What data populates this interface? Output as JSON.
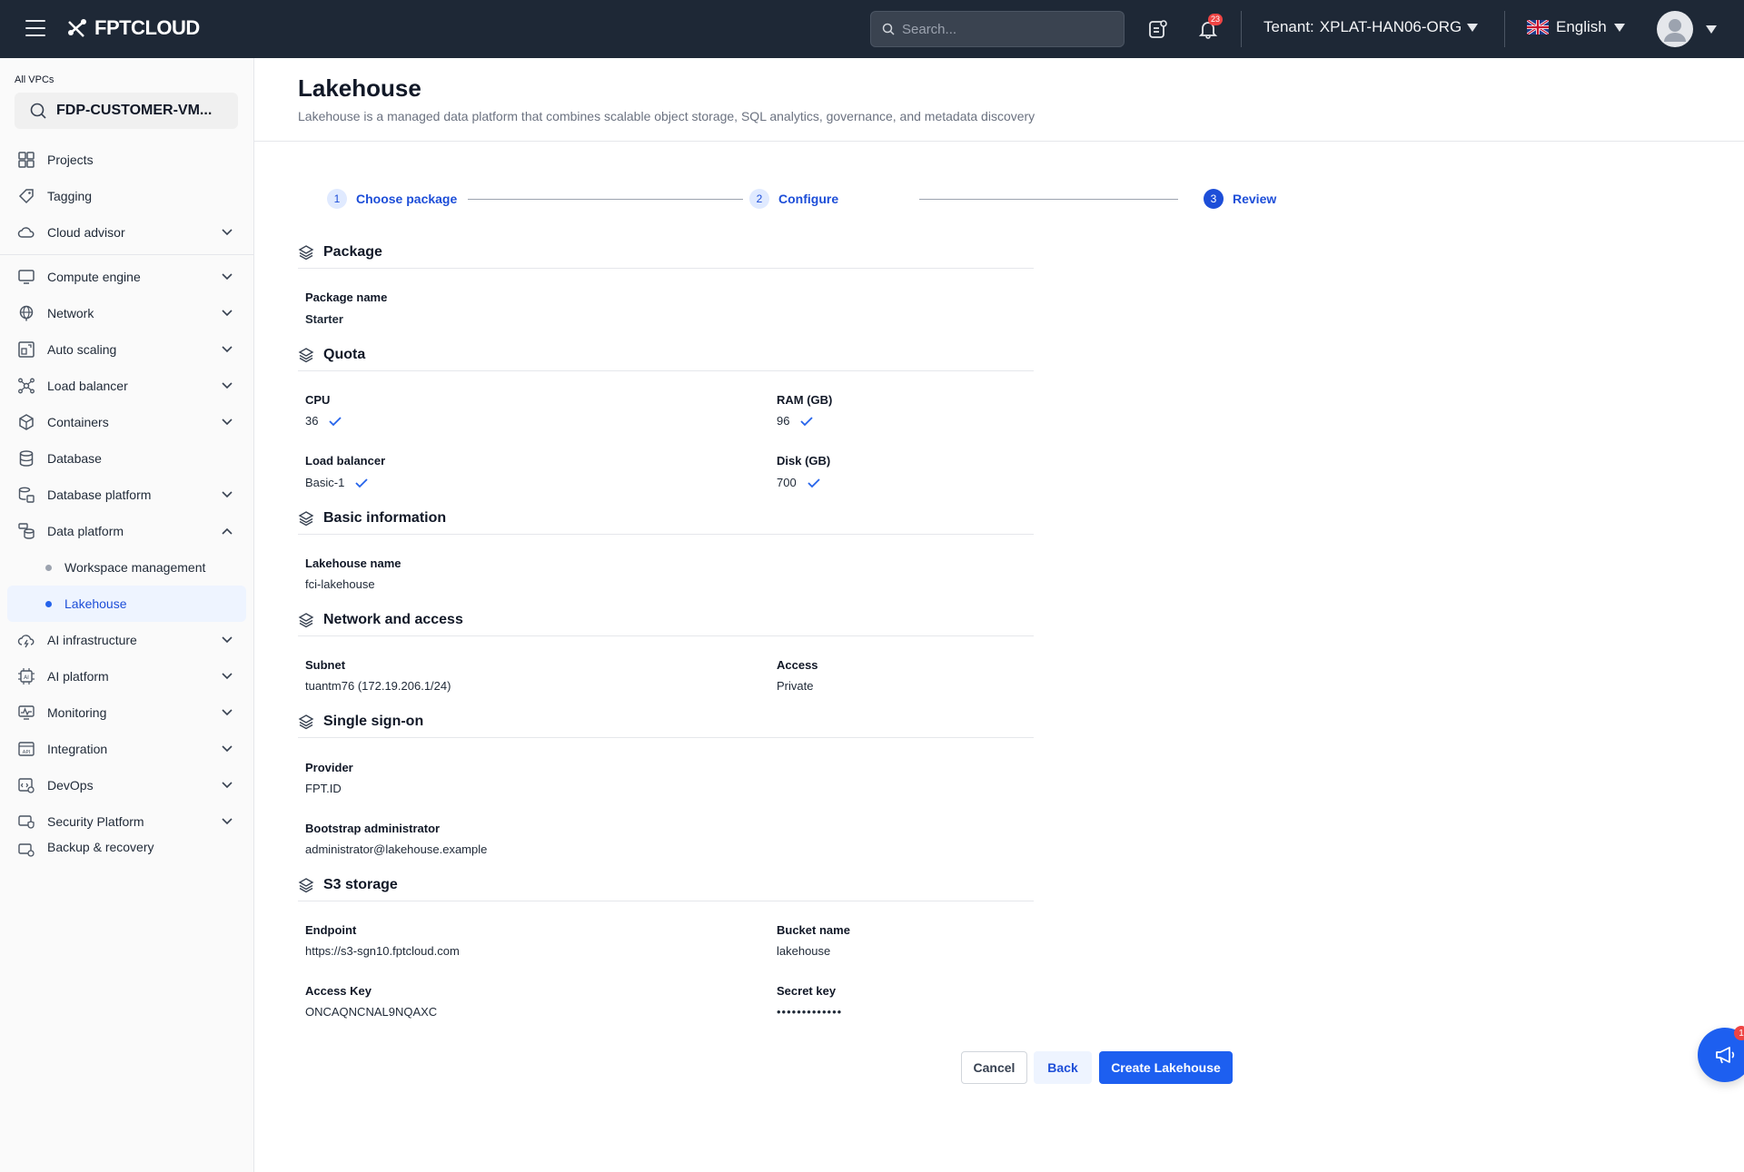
{
  "topbar": {
    "logo_text": "FPTCLOUD",
    "search_placeholder": "Search...",
    "notification_count": "23",
    "tenant_label": "Tenant:",
    "tenant_value": "XPLAT-HAN06-ORG",
    "language": "English"
  },
  "sidebar": {
    "vpc_label": "All VPCs",
    "vpc_value": "FDP-CUSTOMER-VM...",
    "items": {
      "projects": "Projects",
      "tagging": "Tagging",
      "cloud_advisor": "Cloud advisor",
      "compute_engine": "Compute engine",
      "network": "Network",
      "auto_scaling": "Auto scaling",
      "load_balancer": "Load balancer",
      "containers": "Containers",
      "database": "Database",
      "database_platform": "Database platform",
      "data_platform": "Data platform",
      "workspace_management": "Workspace management",
      "lakehouse": "Lakehouse",
      "ai_infrastructure": "AI infrastructure",
      "ai_platform": "AI platform",
      "monitoring": "Monitoring",
      "integration": "Integration",
      "devops": "DevOps",
      "security_platform": "Security Platform",
      "backup_recovery": "Backup & recovery"
    }
  },
  "page": {
    "title": "Lakehouse",
    "subtitle": "Lakehouse is a managed data platform that combines scalable object storage, SQL analytics, governance, and metadata discovery"
  },
  "stepper": {
    "steps": [
      {
        "num": "1",
        "label": "Choose package"
      },
      {
        "num": "2",
        "label": "Configure"
      },
      {
        "num": "3",
        "label": "Review"
      }
    ]
  },
  "review": {
    "package": {
      "heading": "Package",
      "name_label": "Package name",
      "name_value": "Starter"
    },
    "quota": {
      "heading": "Quota",
      "cpu_label": "CPU",
      "cpu_value": "36",
      "ram_label": "RAM (GB)",
      "ram_value": "96",
      "lb_label": "Load balancer",
      "lb_value": "Basic-1",
      "disk_label": "Disk (GB)",
      "disk_value": "700"
    },
    "basic": {
      "heading": "Basic information",
      "name_label": "Lakehouse name",
      "name_value": "fci-lakehouse"
    },
    "network": {
      "heading": "Network and access",
      "subnet_label": "Subnet",
      "subnet_value": "tuantm76 (172.19.206.1/24)",
      "access_label": "Access",
      "access_value": "Private"
    },
    "sso": {
      "heading": "Single sign-on",
      "provider_label": "Provider",
      "provider_value": "FPT.ID",
      "admin_label": "Bootstrap administrator",
      "admin_value": "administrator@lakehouse.example"
    },
    "s3": {
      "heading": "S3 storage",
      "endpoint_label": "Endpoint",
      "endpoint_value": "https://s3-sgn10.fptcloud.com",
      "bucket_label": "Bucket name",
      "bucket_value": "lakehouse",
      "access_key_label": "Access Key",
      "access_key_value": "ONCAQNCNAL9NQAXC",
      "secret_key_label": "Secret key",
      "secret_key_value": "•••••••••••••"
    }
  },
  "actions": {
    "cancel": "Cancel",
    "back": "Back",
    "create": "Create Lakehouse"
  },
  "fab": {
    "badge": "1"
  },
  "colors": {
    "topbar": "#1e2836",
    "accent": "#1d5ff0",
    "active_text": "#1d4ed8"
  }
}
